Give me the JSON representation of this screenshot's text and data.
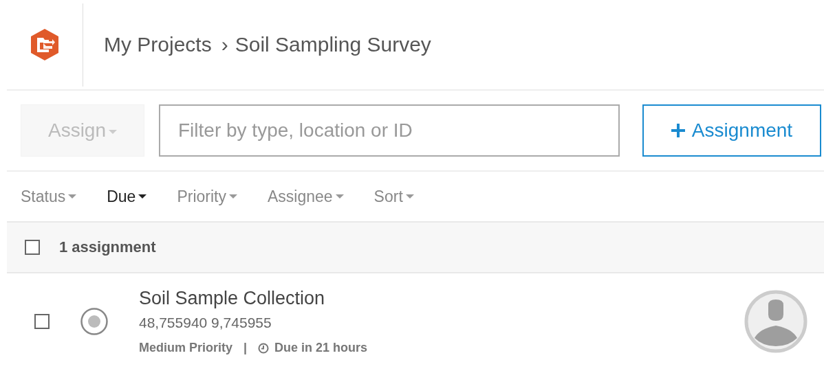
{
  "breadcrumb": [
    {
      "label": "My Projects"
    },
    {
      "label": "Soil Sampling Survey"
    }
  ],
  "breadcrumb_separator": "›",
  "toolbar": {
    "assign_button": {
      "label": "Assign",
      "disabled": true
    },
    "filter": {
      "placeholder": "Filter by type, location or ID"
    },
    "add_button": {
      "label": "Assignment"
    }
  },
  "filters": [
    {
      "label": "Status",
      "selected": false
    },
    {
      "label": "Due",
      "selected": true
    },
    {
      "label": "Priority",
      "selected": false
    },
    {
      "label": "Assignee",
      "selected": false
    },
    {
      "label": "Sort",
      "selected": false
    }
  ],
  "list_header": {
    "checked": false,
    "count": "1 assignment"
  },
  "assignments": [
    {
      "checked": false,
      "title": "Soil Sample Collection",
      "location": "48,755940 9,745955",
      "priority": "Medium Priority",
      "separator": "|",
      "due": "Due in 21 hours"
    }
  ]
}
